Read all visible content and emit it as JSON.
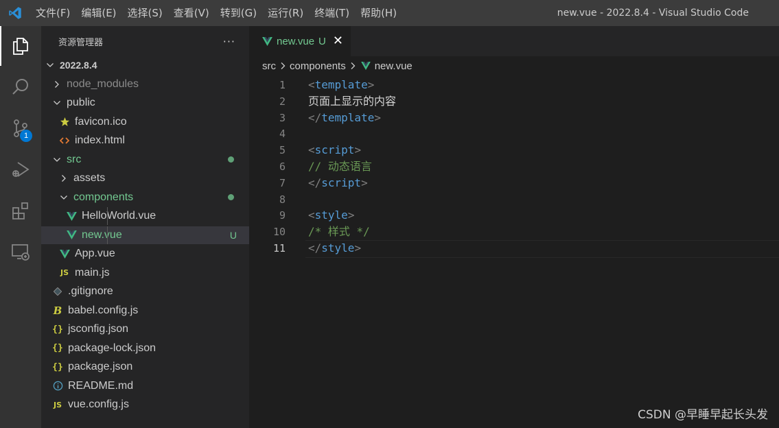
{
  "window": {
    "title": "new.vue - 2022.8.4 - Visual Studio Code"
  },
  "menu": [
    "文件(F)",
    "编辑(E)",
    "选择(S)",
    "查看(V)",
    "转到(G)",
    "运行(R)",
    "终端(T)",
    "帮助(H)"
  ],
  "activity_bar": {
    "items": [
      "explorer-icon",
      "search-icon",
      "source-control-icon",
      "run-debug-icon",
      "extensions-icon",
      "remote-explorer-icon"
    ],
    "scm_badge": "1"
  },
  "explorer": {
    "title": "资源管理器",
    "more_label": "···",
    "root": "2022.8.4",
    "items": [
      {
        "label": "node_modules",
        "type": "folder",
        "expanded": false
      },
      {
        "label": "public",
        "type": "folder",
        "expanded": true
      },
      {
        "label": "favicon.ico",
        "type": "file",
        "icon": "star-icon"
      },
      {
        "label": "index.html",
        "type": "file",
        "icon": "html-icon"
      },
      {
        "label": "src",
        "type": "folder",
        "expanded": true
      },
      {
        "label": "assets",
        "type": "folder",
        "expanded": false
      },
      {
        "label": "components",
        "type": "folder",
        "expanded": true
      },
      {
        "label": "HelloWorld.vue",
        "type": "file",
        "icon": "vue-icon"
      },
      {
        "label": "new.vue",
        "type": "file",
        "icon": "vue-icon",
        "status": "U"
      },
      {
        "label": "App.vue",
        "type": "file",
        "icon": "vue-icon"
      },
      {
        "label": "main.js",
        "type": "file",
        "icon": "js-icon",
        "icon_text": "JS"
      },
      {
        "label": ".gitignore",
        "type": "file",
        "icon": "git-icon"
      },
      {
        "label": "babel.config.js",
        "type": "file",
        "icon": "babel-icon",
        "icon_text": "B"
      },
      {
        "label": "jsconfig.json",
        "type": "file",
        "icon": "json-icon",
        "icon_text": "{}"
      },
      {
        "label": "package-lock.json",
        "type": "file",
        "icon": "json-icon",
        "icon_text": "{}"
      },
      {
        "label": "package.json",
        "type": "file",
        "icon": "json-icon",
        "icon_text": "{}"
      },
      {
        "label": "README.md",
        "type": "file",
        "icon": "info-icon"
      },
      {
        "label": "vue.config.js",
        "type": "file",
        "icon": "js-icon",
        "icon_text": "JS"
      }
    ]
  },
  "editor": {
    "tab": {
      "label": "new.vue",
      "status": "U",
      "close": "✕"
    },
    "breadcrumbs": [
      "src",
      "components",
      "new.vue"
    ],
    "current_line": "11",
    "lines": [
      {
        "n": "1",
        "parts": [
          [
            "tag-br",
            "<"
          ],
          [
            "tag-nm",
            "template"
          ],
          [
            "tag-br",
            ">"
          ]
        ]
      },
      {
        "n": "2",
        "parts": [
          [
            "txt",
            "页面上显示的内容"
          ]
        ]
      },
      {
        "n": "3",
        "parts": [
          [
            "tag-br",
            "</"
          ],
          [
            "tag-nm",
            "template"
          ],
          [
            "tag-br",
            ">"
          ]
        ]
      },
      {
        "n": "4",
        "parts": []
      },
      {
        "n": "5",
        "parts": [
          [
            "tag-br",
            "<"
          ],
          [
            "tag-nm",
            "script"
          ],
          [
            "tag-br",
            ">"
          ]
        ]
      },
      {
        "n": "6",
        "parts": [
          [
            "cmt",
            "// 动态语言"
          ]
        ]
      },
      {
        "n": "7",
        "parts": [
          [
            "tag-br",
            "</"
          ],
          [
            "tag-nm",
            "script"
          ],
          [
            "tag-br",
            ">"
          ]
        ]
      },
      {
        "n": "8",
        "parts": []
      },
      {
        "n": "9",
        "parts": [
          [
            "tag-br",
            "<"
          ],
          [
            "tag-nm",
            "style"
          ],
          [
            "tag-br",
            ">"
          ]
        ]
      },
      {
        "n": "10",
        "parts": [
          [
            "cmt",
            "/* 样式 */"
          ]
        ]
      },
      {
        "n": "11",
        "parts": [
          [
            "tag-br",
            "</"
          ],
          [
            "tag-nm",
            "style"
          ],
          [
            "tag-br",
            ">"
          ]
        ]
      }
    ]
  },
  "watermark": "CSDN @早睡早起长头发",
  "colors": {
    "vue_green": "#41b883",
    "untracked": "#73c991",
    "accent_blue": "#0078d4",
    "js_yellow": "#cbcb41",
    "html_orange": "#e37933"
  }
}
